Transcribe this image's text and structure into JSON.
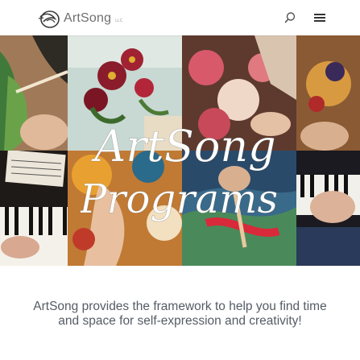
{
  "header": {
    "logo_text": "ArtSong",
    "logo_suffix": "LLC",
    "search_icon": "search-icon",
    "menu_icon": "hamburger-menu-icon"
  },
  "hero": {
    "title_line1": "ArtSong",
    "title_line2": "Programs"
  },
  "tagline": {
    "line1": "ArtSong provides the framework to help you find time",
    "line2": "and space for self-expression and creativity!"
  }
}
